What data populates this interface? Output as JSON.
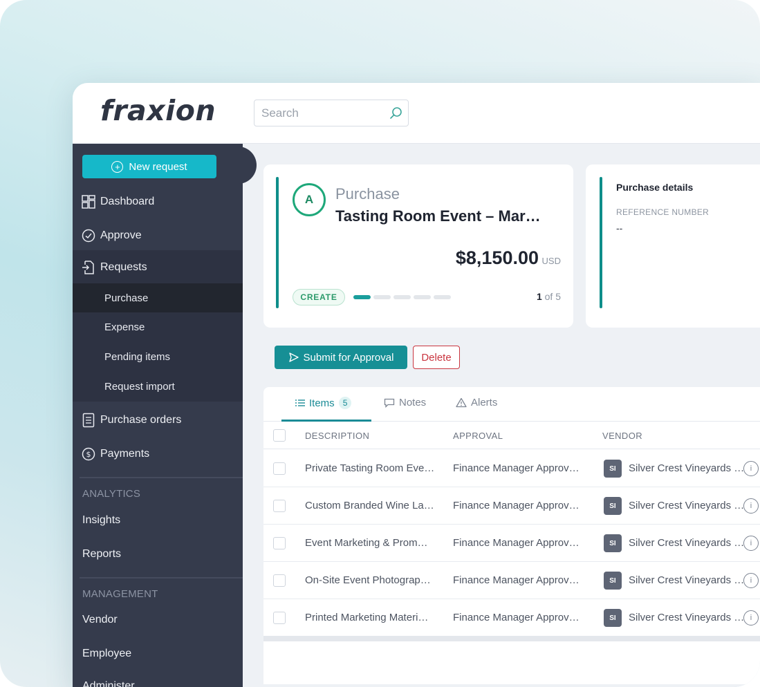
{
  "brand": {
    "logo_text": "fraxion"
  },
  "search": {
    "placeholder": "Search"
  },
  "sidebar": {
    "new_request_label": "New request",
    "items": {
      "dashboard": "Dashboard",
      "approve": "Approve",
      "requests": "Requests",
      "purchase": "Purchase",
      "expense": "Expense",
      "pending_items": "Pending items",
      "request_import": "Request import",
      "purchase_orders": "Purchase orders",
      "payments": "Payments"
    },
    "analytics": {
      "label": "ANALYTICS",
      "insights": "Insights",
      "reports": "Reports"
    },
    "management": {
      "label": "MANAGEMENT",
      "vendor": "Vendor",
      "employee": "Employee",
      "administer": "Administer"
    }
  },
  "summary": {
    "avatar_letter": "A",
    "type": "Purchase",
    "title": "Tasting Room Event – Mar…",
    "amount": "$8,150.00",
    "currency": "USD",
    "stage": "CREATE",
    "progress": {
      "current": 1,
      "total": 5
    },
    "step_current": "1",
    "step_rest": "of 5"
  },
  "details": {
    "title": "Purchase details",
    "reference_label": "REFERENCE NUMBER",
    "reference_value": "--"
  },
  "actions": {
    "submit_label": "Submit for Approval",
    "delete_label": "Delete"
  },
  "tabs": {
    "items_label": "Items",
    "items_count": "5",
    "notes_label": "Notes",
    "alerts_label": "Alerts"
  },
  "table": {
    "columns": {
      "description": "DESCRIPTION",
      "approval": "APPROVAL",
      "vendor": "VENDOR"
    },
    "rows": [
      {
        "description": "Private Tasting Room Eve…",
        "approval": "Finance Manager Approv…",
        "vendor_initials": "SI",
        "vendor": "Silver Crest Vineyards …"
      },
      {
        "description": "Custom Branded Wine La…",
        "approval": "Finance Manager Approv…",
        "vendor_initials": "SI",
        "vendor": "Silver Crest Vineyards …"
      },
      {
        "description": "Event Marketing & Prom…",
        "approval": "Finance Manager Approv…",
        "vendor_initials": "SI",
        "vendor": "Silver Crest Vineyards …"
      },
      {
        "description": "On-Site Event Photograp…",
        "approval": "Finance Manager Approv…",
        "vendor_initials": "SI",
        "vendor": "Silver Crest Vineyards …"
      },
      {
        "description": "Printed Marketing Materi…",
        "approval": "Finance Manager Approv…",
        "vendor_initials": "SI",
        "vendor": "Silver Crest Vineyards …"
      }
    ]
  },
  "colors": {
    "sidebar_bg": "#353b4c",
    "accent_teal": "#168f95",
    "new_request_cyan": "#16b8c9",
    "delete_red": "#c9343e",
    "create_green": "#2b9a6a"
  }
}
